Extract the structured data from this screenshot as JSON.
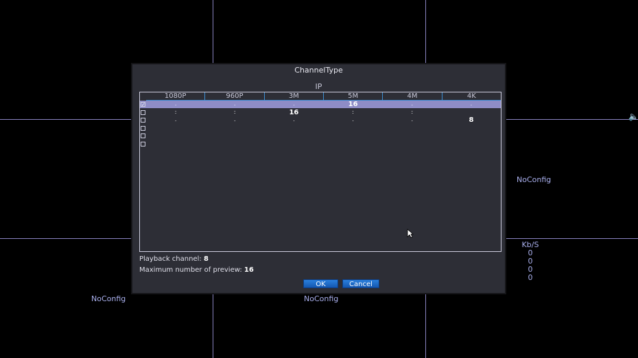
{
  "background": {
    "labels": {
      "nc_right": "NoConfig",
      "nc_bottom_left": "NoConfig",
      "nc_bottom_mid": "NoConfig"
    },
    "kbs": {
      "header": "Kb/S",
      "values": [
        "0",
        "0",
        "0",
        "0"
      ]
    }
  },
  "dialog": {
    "title": "ChannelType",
    "group": "IP",
    "columns": [
      "1080P",
      "960P",
      "3M",
      "5M",
      "4M",
      "4K"
    ],
    "rows": [
      {
        "checked": true,
        "selected": true,
        "cells": [
          ".",
          ".",
          ".",
          "16",
          ".",
          "."
        ]
      },
      {
        "checked": false,
        "selected": false,
        "cells": [
          ":",
          ":",
          "16",
          ":",
          ":",
          ""
        ]
      },
      {
        "checked": false,
        "selected": false,
        "cells": [
          ".",
          ".",
          ".",
          ".",
          ".",
          "8"
        ]
      },
      {
        "checked": false,
        "selected": false,
        "cells": [
          "",
          "",
          "",
          "",
          "",
          ""
        ]
      },
      {
        "checked": false,
        "selected": false,
        "cells": [
          "",
          "",
          "",
          "",
          "",
          ""
        ]
      },
      {
        "checked": false,
        "selected": false,
        "cells": [
          "",
          "",
          "",
          "",
          "",
          ""
        ]
      }
    ],
    "playback_label": "Playback channel:",
    "playback_value": "8",
    "preview_label": "Maximum number of preview:",
    "preview_value": "16",
    "ok_label": "OK",
    "cancel_label": "Cancel"
  },
  "colors": {
    "accent": "#1e6cd0",
    "selected_row": "#8e8cc6",
    "grid": "#8c86c4"
  }
}
